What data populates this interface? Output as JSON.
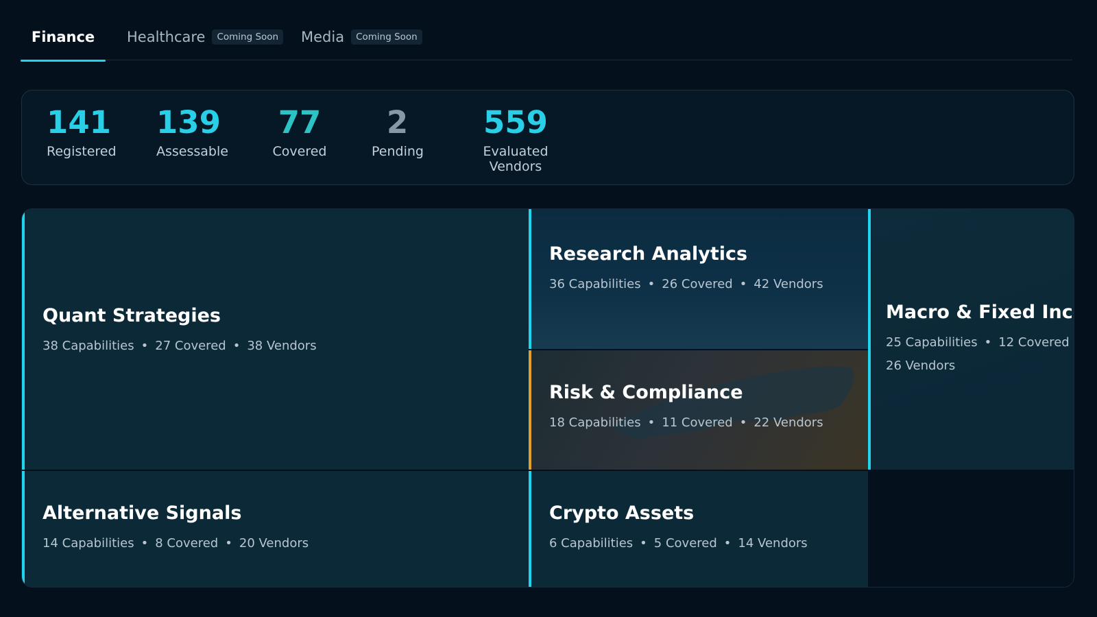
{
  "tabs": [
    {
      "label": "Finance",
      "active": true
    },
    {
      "label": "Healthcare",
      "badge": "Coming Soon"
    },
    {
      "label": "Media",
      "badge": "Coming Soon"
    }
  ],
  "stats": [
    {
      "value": "141",
      "label": "Registered"
    },
    {
      "value": "139",
      "label": "Assessable"
    },
    {
      "value": "77",
      "label": "Covered"
    },
    {
      "value": "2",
      "label": "Pending"
    },
    {
      "value": "559",
      "label": "Evaluated Vendors"
    }
  ],
  "tiles": {
    "quant": {
      "title": "Quant Strategies",
      "capabilities": "38 Capabilities",
      "covered": "27 Covered",
      "vendors": "38 Vendors"
    },
    "research": {
      "title": "Research Analytics",
      "capabilities": "36 Capabilities",
      "covered": "26 Covered",
      "vendors": "42 Vendors"
    },
    "macro": {
      "title": "Macro & Fixed Income",
      "capabilities": "25 Capabilities",
      "covered": "12 Covered",
      "vendors": "26 Vendors"
    },
    "risk": {
      "title": "Risk & Compliance",
      "capabilities": "18 Capabilities",
      "covered": "11 Covered",
      "vendors": "22 Vendors"
    },
    "alt": {
      "title": "Alternative Signals",
      "capabilities": "14 Capabilities",
      "covered": "8 Covered",
      "vendors": "20 Vendors"
    },
    "crypto": {
      "title": "Crypto Assets",
      "capabilities": "6 Capabilities",
      "covered": "5 Covered",
      "vendors": "14 Vendors"
    }
  },
  "colors": {
    "accent": "#22d3ee",
    "warning": "#e0a030",
    "background": "#04111d"
  }
}
